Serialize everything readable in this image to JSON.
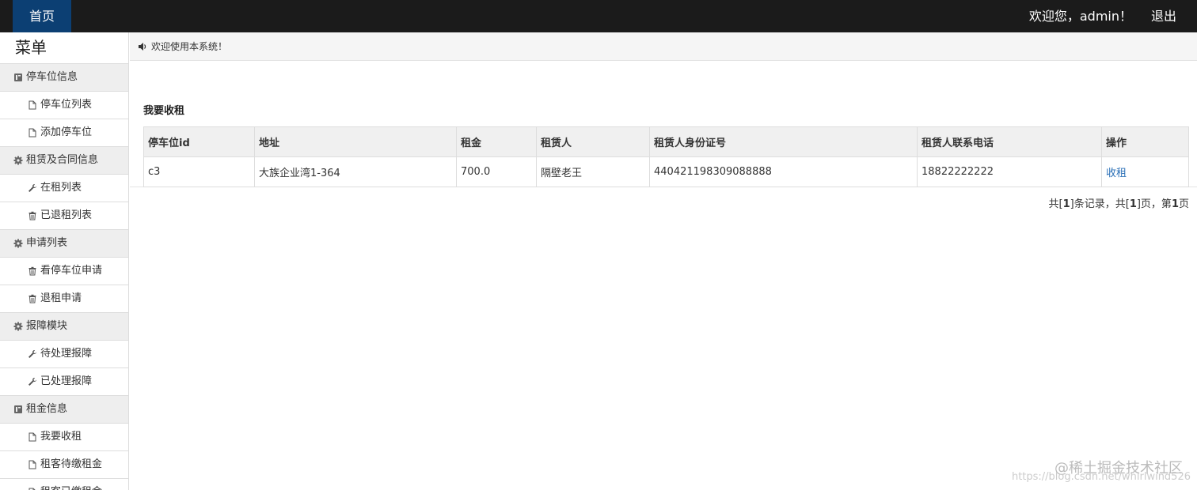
{
  "topbar": {
    "home_label": "首页",
    "welcome_text": "欢迎您，admin！",
    "logout_label": "退出"
  },
  "sidebar": {
    "title": "菜单",
    "groups": [
      {
        "label": "停车位信息",
        "icon": "book-icon",
        "items": [
          {
            "label": "停车位列表",
            "icon": "file-icon"
          },
          {
            "label": "添加停车位",
            "icon": "file-icon"
          }
        ]
      },
      {
        "label": "租赁及合同信息",
        "icon": "gear-icon",
        "items": [
          {
            "label": "在租列表",
            "icon": "wrench-icon"
          },
          {
            "label": "已退租列表",
            "icon": "trash-icon"
          }
        ]
      },
      {
        "label": "申请列表",
        "icon": "gear-icon",
        "items": [
          {
            "label": "看停车位申请",
            "icon": "trash-icon"
          },
          {
            "label": "退租申请",
            "icon": "trash-icon"
          }
        ]
      },
      {
        "label": "报障模块",
        "icon": "gear-icon",
        "items": [
          {
            "label": "待处理报障",
            "icon": "wrench-icon"
          },
          {
            "label": "已处理报障",
            "icon": "wrench-icon"
          }
        ]
      },
      {
        "label": "租金信息",
        "icon": "book-icon",
        "items": [
          {
            "label": "我要收租",
            "icon": "file-icon"
          },
          {
            "label": "租客待缴租金",
            "icon": "file-icon"
          },
          {
            "label": "租客已缴租金",
            "icon": "file-icon"
          }
        ]
      }
    ]
  },
  "notice": {
    "icon": "volume-icon",
    "text": "欢迎使用本系统！"
  },
  "panel": {
    "title": "我要收租",
    "columns": [
      "停车位id",
      "地址",
      "租金",
      "租赁人",
      "租赁人身份证号",
      "租赁人联系电话",
      "操作"
    ],
    "rows": [
      {
        "id": "c3",
        "address": "大族企业湾1-364",
        "rent": "700.0",
        "tenant": "隔壁老王",
        "id_number": "440421198309088888",
        "phone": "18822222222",
        "action": "收租"
      }
    ],
    "pager": {
      "p1": "共[",
      "total_records": "1",
      "p2": "]条记录，共[",
      "total_pages": "1",
      "p3": "]页，第",
      "current_page": "1",
      "p4": "页"
    }
  },
  "watermark": {
    "main": "@稀土掘金技术社区",
    "sub": "https://blog.csdn.net/whirlwind526"
  }
}
